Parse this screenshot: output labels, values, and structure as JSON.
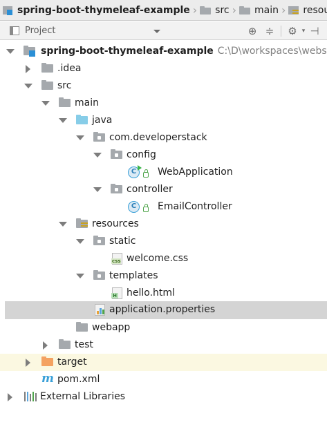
{
  "breadcrumb": {
    "items": [
      {
        "label": "spring-boot-thymeleaf-example",
        "icon": "module-icon"
      },
      {
        "label": "src",
        "icon": "folder-icon"
      },
      {
        "label": "main",
        "icon": "folder-icon"
      },
      {
        "label": "resources",
        "icon": "resources-folder-icon"
      }
    ]
  },
  "tool_window": {
    "title": "Project",
    "actions": [
      "locate-icon",
      "collapse-all-icon",
      "settings-icon",
      "hide-icon"
    ]
  },
  "tree": {
    "root": {
      "label": "spring-boot-thymeleaf-example",
      "path": "C:\\D\\workspaces\\website_m"
    },
    "idea": ".idea",
    "src": "src",
    "main": "main",
    "java": "java",
    "package": "com.developerstack",
    "config": "config",
    "web_application": "WebApplication",
    "controller": "controller",
    "email_controller": "EmailController",
    "resources": "resources",
    "static": "static",
    "welcome_css": "welcome.css",
    "templates": "templates",
    "hello_html": "hello.html",
    "application_properties": "application.properties",
    "webapp": "webapp",
    "test": "test",
    "target": "target",
    "pom": "pom.xml",
    "external_libraries": "External Libraries",
    "selected": "application.properties"
  },
  "icons": {
    "css_badge": "css",
    "html_badge": "H",
    "class_badge": "C"
  },
  "colors": {
    "selection": "#d4d4d4",
    "excluded_row": "#fbf8e1",
    "source_folder": "#87cde8",
    "excluded_folder": "#f4a261",
    "folder": "#a5a9ad"
  }
}
